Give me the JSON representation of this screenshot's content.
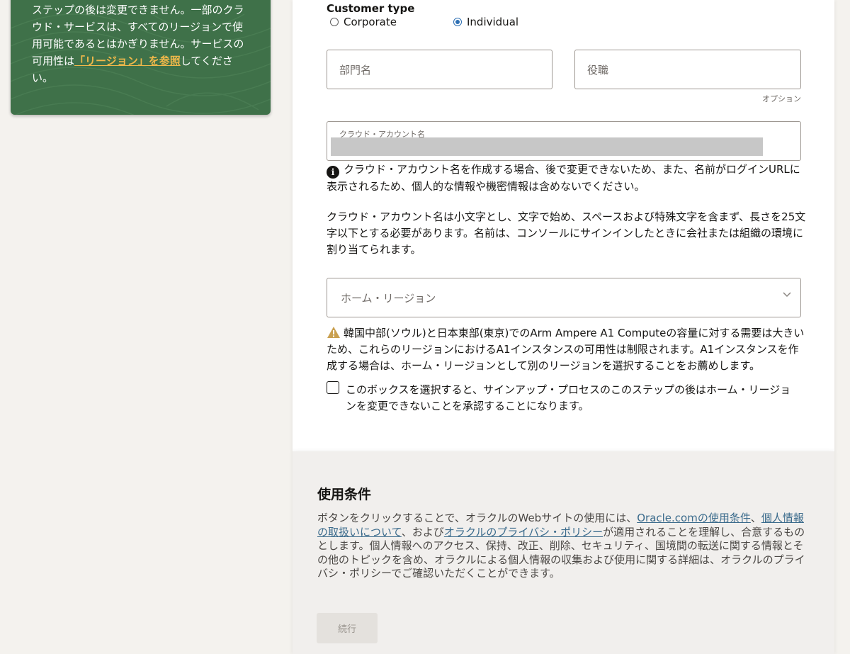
{
  "info_card": {
    "text_before_link": "ステップの後は変更できません。一部のクラウド・サービスは、すべてのリージョンで使用可能であるとはかぎりません。サービスの可用性は",
    "link": "「リージョン」を参照",
    "text_after_link": "してください。"
  },
  "customer_type": {
    "label": "Customer type",
    "options": [
      {
        "label": "Corporate",
        "selected": false
      },
      {
        "label": "Individual",
        "selected": true
      }
    ]
  },
  "fields": {
    "department_placeholder": "部門名",
    "job_title_placeholder": "役職",
    "optional_note": "オプション",
    "cloud_account_label": "クラウド・アカウント名",
    "home_region_placeholder": "ホーム・リージョン"
  },
  "notes": {
    "account_info_1": "クラウド・アカウント名を作成する場合、後で変更できないため、また、名前がログインURLに表示されるため、個人的な情報や機密情報は含めないでください。",
    "account_info_2": "クラウド・アカウント名は小文字とし、文字で始め、スペースおよび特殊文字を含まず、長さを25文字以下とする必要があります。名前は、コンソールにサインインしたときに会社または組織の環境に割り当てられます。",
    "region_warning": "韓国中部(ソウル)と日本東部(東京)でのArm Ampere A1 Computeの容量に対する需要は大きいため、これらのリージョンにおけるA1インスタンスの可用性は制限されます。A1インスタンスを作成する場合は、ホーム・リージョンとして別のリージョンを選択することをお薦めします。",
    "checkbox_label": "このボックスを選択すると、サインアップ・プロセスのこのステップの後はホーム・リージョンを変更できないことを承認することになります。"
  },
  "terms": {
    "title": "使用条件",
    "text_1": "ボタンをクリックすることで、オラクルのWebサイトの使用には、",
    "link_1": "Oracle.comの使用条件",
    "sep_1": "、",
    "link_2": "個人情報の取扱いについて",
    "text_2": "、および",
    "link_3": "オラクルのプライバシ・ポリシー",
    "text_3": "が適用されることを理解し、合意するものとします。個人情報へのアクセス、保持、改正、削除、セキュリティ、国境間の転送に関する情報とその他のトピックを含め、オラクルによる個人情報の収集および使用に関する詳細は、オラクルのプライバシ・ポリシーでご確認いただくことができます。"
  },
  "continue_button": "続行",
  "colors": {
    "card_green": "#3f7149",
    "link_orange": "#f0b84a",
    "radio_blue": "#2d6fb3",
    "terms_link": "#3b6b8c",
    "warning": "#c9a050"
  }
}
